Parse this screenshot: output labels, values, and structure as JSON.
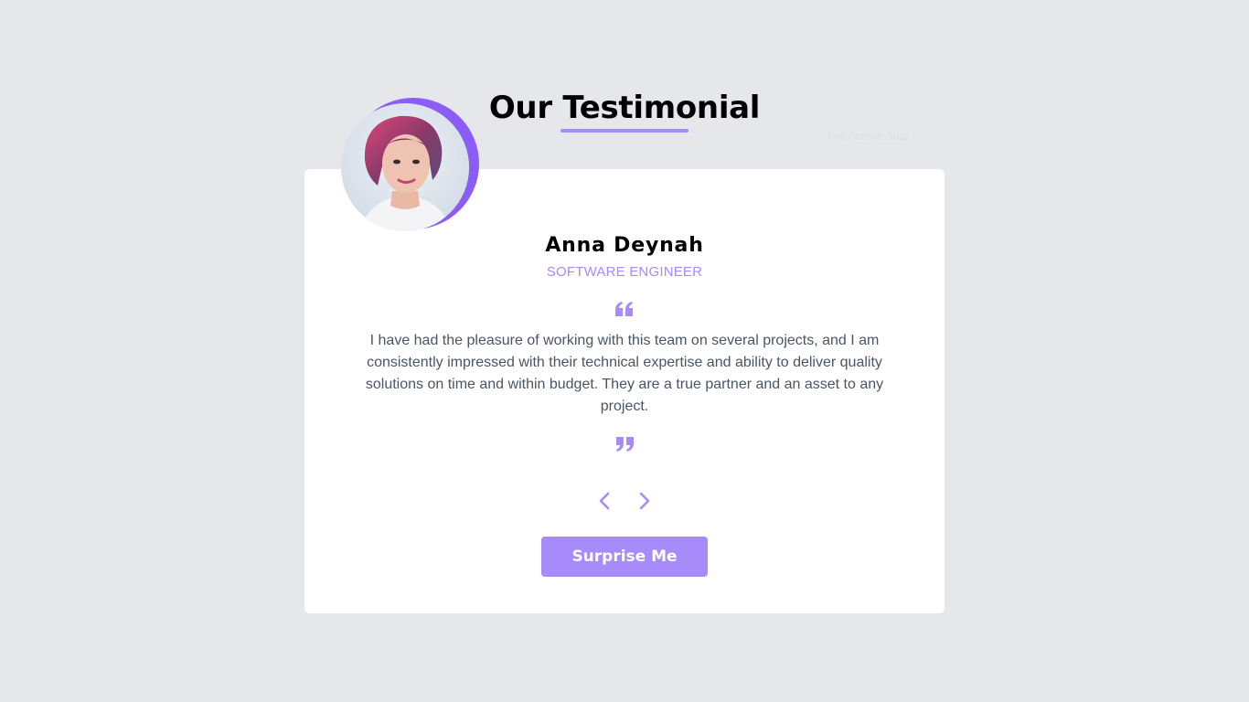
{
  "header": {
    "title": "Our Testimonial",
    "ghost_badge": "Full Screen Snip"
  },
  "testimonial": {
    "name": "Anna Deynah",
    "role": "SOFTWARE ENGINEER",
    "quote": "I have had the pleasure of working with this team on several projects, and I am consistently impressed with their technical expertise and ability to deliver quality solutions on time and within budget. They are a true partner and an asset to any project."
  },
  "icons": {
    "quote_open": "quote-open-icon",
    "quote_close": "quote-close-icon",
    "prev": "chevron-left-icon",
    "next": "chevron-right-icon"
  },
  "actions": {
    "surprise_label": "Surprise Me"
  },
  "colors": {
    "accent": "#a78bfa",
    "accent_dark": "#8b5cf6",
    "background": "#e5e7eb",
    "card": "#ffffff",
    "text": "#4b5563"
  }
}
